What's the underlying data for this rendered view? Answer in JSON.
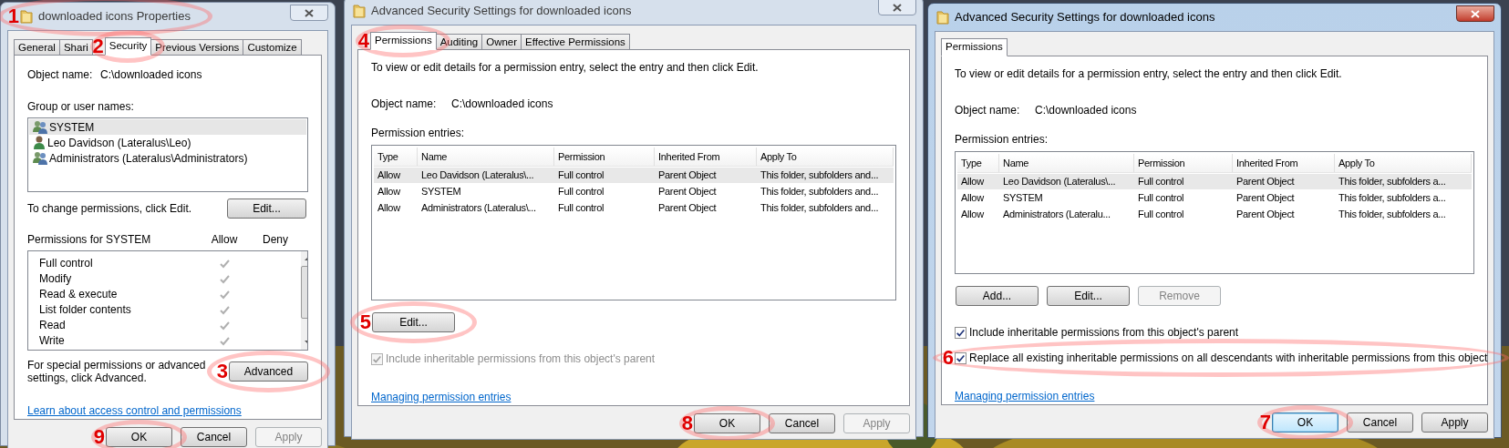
{
  "windows": [
    {
      "kind": "properties",
      "active": false,
      "title": "downloaded icons Properties",
      "title_annotation": "1",
      "tabs": [
        {
          "label": "General",
          "selected": false
        },
        {
          "label": "Shari",
          "selected": false
        },
        {
          "label": "Security",
          "selected": true,
          "annotation": "2"
        },
        {
          "label": "Previous Versions",
          "selected": false
        },
        {
          "label": "Customize",
          "selected": false
        }
      ],
      "object_name_label": "Object name:",
      "object_name": "C:\\downloaded icons",
      "users_label": "Group or user names:",
      "users": [
        {
          "name": "SYSTEM",
          "kind": "group",
          "selected": true
        },
        {
          "name": "Leo Davidson (Lateralus\\Leo)",
          "kind": "user",
          "selected": false
        },
        {
          "name": "Administrators (Lateralus\\Administrators)",
          "kind": "group",
          "selected": false
        }
      ],
      "change_hint": "To change permissions, click Edit.",
      "edit_button": "Edit...",
      "permissions_label": "Permissions for SYSTEM",
      "allow_label": "Allow",
      "deny_label": "Deny",
      "permissions": [
        {
          "name": "Full control",
          "allow": true,
          "deny": false
        },
        {
          "name": "Modify",
          "allow": true,
          "deny": false
        },
        {
          "name": "Read & execute",
          "allow": true,
          "deny": false
        },
        {
          "name": "List folder contents",
          "allow": true,
          "deny": false
        },
        {
          "name": "Read",
          "allow": true,
          "deny": false
        },
        {
          "name": "Write",
          "allow": true,
          "deny": false
        }
      ],
      "advanced_hint": "For special permissions or advanced settings, click Advanced.",
      "advanced_button": {
        "label": "Advanced",
        "annotation": "3"
      },
      "link": "Learn about access control and permissions",
      "buttons": [
        {
          "label": "OK",
          "disabled": false,
          "focused": false,
          "annotation": "9"
        },
        {
          "label": "Cancel",
          "disabled": false,
          "focused": false
        },
        {
          "label": "Apply",
          "disabled": true,
          "focused": false
        }
      ]
    },
    {
      "kind": "advanced",
      "active": false,
      "title": "Advanced Security Settings for downloaded icons",
      "tabs": [
        {
          "label": "Permissions",
          "selected": true,
          "annotation": "4"
        },
        {
          "label": "Auditing",
          "selected": false
        },
        {
          "label": "Owner",
          "selected": false
        },
        {
          "label": "Effective Permissions",
          "selected": false
        }
      ],
      "hint": "To view or edit details for a permission entry, select the entry and then click Edit.",
      "object_name_label": "Object name:",
      "object_name": "C:\\downloaded icons",
      "entries_label": "Permission entries:",
      "columns": [
        "Type",
        "Name",
        "Permission",
        "Inherited From",
        "Apply To"
      ],
      "rows": [
        {
          "cells": [
            "Allow",
            "Leo Davidson (Lateralus\\...",
            "Full control",
            "Parent Object",
            "This folder, subfolders and..."
          ],
          "selected": true
        },
        {
          "cells": [
            "Allow",
            "SYSTEM",
            "Full control",
            "Parent Object",
            "This folder, subfolders and..."
          ],
          "selected": false
        },
        {
          "cells": [
            "Allow",
            "Administrators (Lateralus\\...",
            "Full control",
            "Parent Object",
            "This folder, subfolders and..."
          ],
          "selected": false
        }
      ],
      "entry_buttons": [
        {
          "label": "Edit...",
          "disabled": false,
          "annotation": "5"
        }
      ],
      "checkboxes": [
        {
          "label": "Include inheritable permissions from this object's parent",
          "checked": true,
          "disabled": true
        }
      ],
      "link": "Managing permission entries",
      "buttons": [
        {
          "label": "OK",
          "disabled": false,
          "focused": false,
          "annotation": "8"
        },
        {
          "label": "Cancel",
          "disabled": false,
          "focused": false
        },
        {
          "label": "Apply",
          "disabled": true,
          "focused": false
        }
      ]
    },
    {
      "kind": "advanced",
      "active": true,
      "title": "Advanced Security Settings for downloaded icons",
      "tabs": [
        {
          "label": "Permissions",
          "selected": true
        }
      ],
      "hint": "To view or edit details for a permission entry, select the entry and then click Edit.",
      "object_name_label": "Object name:",
      "object_name": "C:\\downloaded icons",
      "entries_label": "Permission entries:",
      "columns": [
        "Type",
        "Name",
        "Permission",
        "Inherited From",
        "Apply To"
      ],
      "rows": [
        {
          "cells": [
            "Allow",
            "Leo Davidson (Lateralus\\...",
            "Full control",
            "Parent Object",
            "This folder, subfolders a..."
          ],
          "selected": true
        },
        {
          "cells": [
            "Allow",
            "SYSTEM",
            "Full control",
            "Parent Object",
            "This folder, subfolders a..."
          ],
          "selected": false
        },
        {
          "cells": [
            "Allow",
            "Administrators (Lateralu...",
            "Full control",
            "Parent Object",
            "This folder, subfolders a..."
          ],
          "selected": false
        }
      ],
      "entry_buttons": [
        {
          "label": "Add...",
          "disabled": false
        },
        {
          "label": "Edit...",
          "disabled": false
        },
        {
          "label": "Remove",
          "disabled": true
        }
      ],
      "checkboxes": [
        {
          "label": "Include inheritable permissions from this object's parent",
          "checked": true,
          "disabled": false
        },
        {
          "label": "Replace all existing inheritable permissions on all descendants with inheritable permissions from this object",
          "checked": true,
          "disabled": false,
          "annotation": "6"
        }
      ],
      "link": "Managing permission entries",
      "buttons": [
        {
          "label": "OK",
          "disabled": false,
          "focused": true,
          "annotation": "7"
        },
        {
          "label": "Cancel",
          "disabled": false,
          "focused": false
        },
        {
          "label": "Apply",
          "disabled": false,
          "focused": false
        }
      ]
    }
  ]
}
